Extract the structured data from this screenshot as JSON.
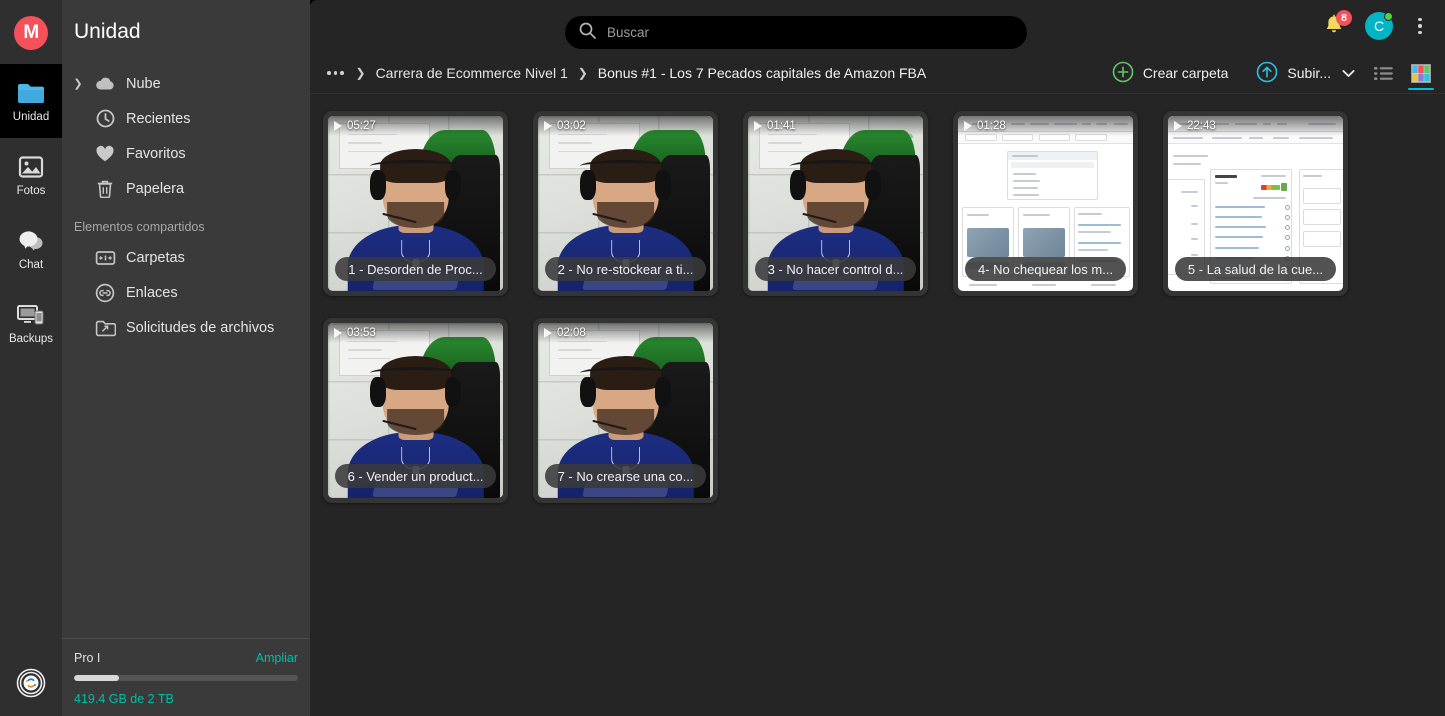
{
  "app": {
    "brand_initial": "M",
    "brand_color": "#f4515b",
    "accent_teal": "#00bfa5",
    "accent_cyan": "#00bfd8",
    "accent_green": "#63c76a"
  },
  "rail": {
    "items": [
      {
        "label": "Unidad",
        "icon": "folder-icon",
        "active": true
      },
      {
        "label": "Fotos",
        "icon": "photo-icon",
        "active": false
      },
      {
        "label": "Chat",
        "icon": "chat-icon",
        "active": false
      },
      {
        "label": "Backups",
        "icon": "devices-icon",
        "active": false
      }
    ],
    "sync_icon": "sync-icon"
  },
  "sidebar": {
    "title": "Unidad",
    "items": [
      {
        "label": "Nube",
        "icon": "cloud-icon",
        "expandable": true
      },
      {
        "label": "Recientes",
        "icon": "clock-icon",
        "expandable": false
      },
      {
        "label": "Favoritos",
        "icon": "heart-icon",
        "expandable": false
      },
      {
        "label": "Papelera",
        "icon": "trash-icon",
        "expandable": false
      }
    ],
    "section_label": "Elementos compartidos",
    "shared_items": [
      {
        "label": "Carpetas",
        "icon": "shared-folder-icon"
      },
      {
        "label": "Enlaces",
        "icon": "link-icon"
      },
      {
        "label": "Solicitudes de archivos",
        "icon": "file-request-icon"
      }
    ],
    "footer": {
      "plan": "Pro I",
      "upgrade_label": "Ampliar",
      "usage_text": "419.4 GB de 2 TB",
      "usage_percent": 20
    }
  },
  "topbar": {
    "search_placeholder": "Buscar",
    "search_value": "",
    "search_icon": "search-icon",
    "notifications_icon": "bell-icon",
    "notifications_count": "8",
    "avatar_initial": "C",
    "avatar_status": "online",
    "menu_icon": "kebab-menu-icon"
  },
  "actionbar": {
    "breadcrumb_overflow": "...",
    "breadcrumbs": [
      "Carrera de Ecommerce Nivel 1",
      "Bonus #1 - Los 7 Pecados capitales de Amazon FBA"
    ],
    "create_folder_label": "Crear carpeta",
    "create_folder_icon": "plus-circle-icon",
    "upload_label": "Subir...",
    "upload_icon": "upload-circle-icon",
    "upload_chevron_icon": "chevron-down-icon",
    "list_view_icon": "list-view-icon",
    "grid_view_icon": "grid-view-icon",
    "active_view": "grid"
  },
  "grid": {
    "items": [
      {
        "duration": "05:27",
        "title": "1 - Desorden de Proc...",
        "thumb": "webcam",
        "variant": "a"
      },
      {
        "duration": "03:02",
        "title": "2 - No re-stockear a ti...",
        "thumb": "webcam",
        "variant": "b"
      },
      {
        "duration": "01:41",
        "title": "3 - No hacer control d...",
        "thumb": "webcam",
        "variant": "c"
      },
      {
        "duration": "01:28",
        "title": "4- No chequear los m...",
        "thumb": "dashboard",
        "variant": "d"
      },
      {
        "duration": "22:43",
        "title": "5 - La salud de la cue...",
        "thumb": "dashboard",
        "variant": "e"
      },
      {
        "duration": "03:53",
        "title": "6 - Vender un product...",
        "thumb": "webcam",
        "variant": "f"
      },
      {
        "duration": "02:08",
        "title": "7 - No crearse una co...",
        "thumb": "webcam",
        "variant": "g"
      }
    ]
  }
}
